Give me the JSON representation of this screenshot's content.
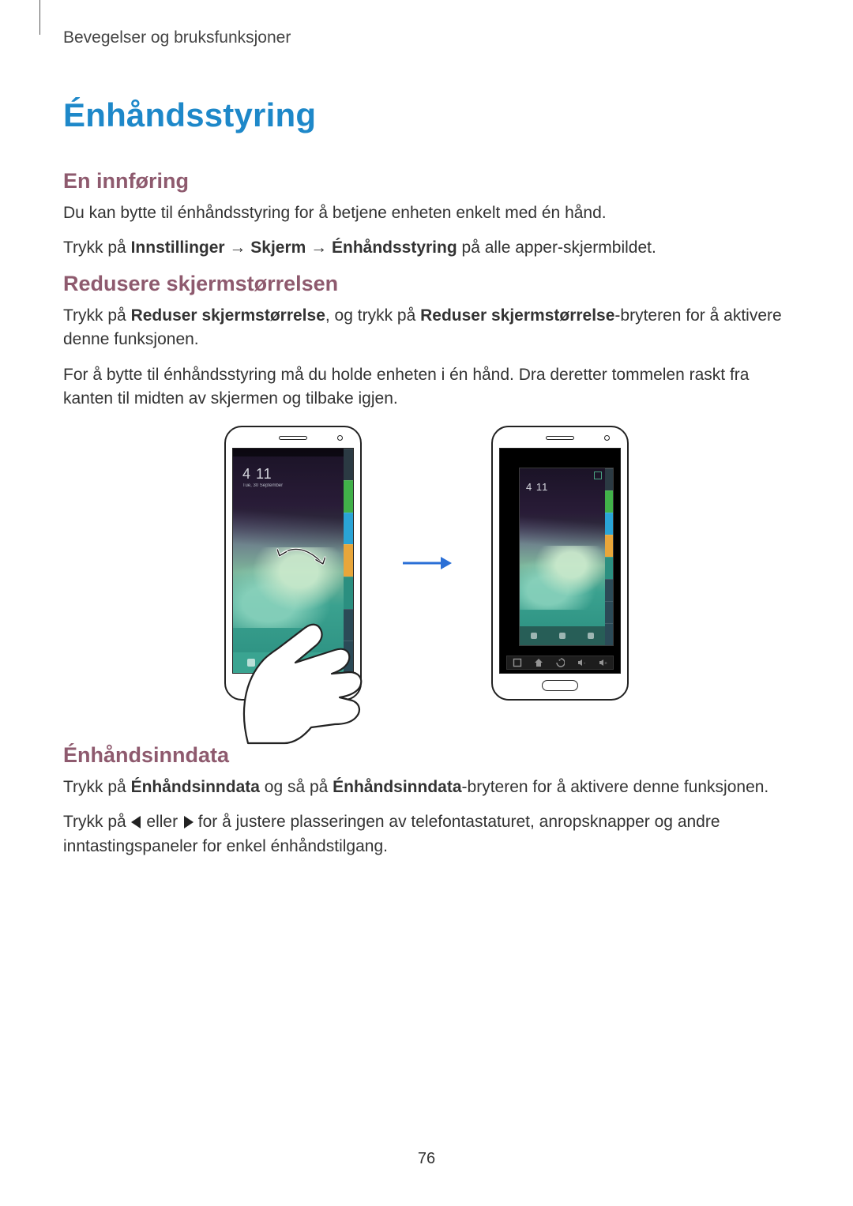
{
  "running_head": "Bevegelser og bruksfunksjoner",
  "title": "Énhåndsstyring",
  "intro": {
    "heading": "En innføring",
    "p1": "Du kan bytte til énhåndsstyring for å betjene enheten enkelt med én hånd.",
    "p2_pre": "Trykk på ",
    "p2_b1": "Innstillinger",
    "p2_arrow1": " → ",
    "p2_b2": "Skjerm",
    "p2_arrow2": " → ",
    "p2_b3": "Énhåndsstyring",
    "p2_post": " på alle apper-skjermbildet."
  },
  "reduce": {
    "heading": "Redusere skjermstørrelsen",
    "p1_pre": "Trykk på ",
    "p1_b1": "Reduser skjermstørrelse",
    "p1_mid": ", og trykk på ",
    "p1_b2": "Reduser skjermstørrelse",
    "p1_post": "-bryteren for å aktivere denne funksjonen.",
    "p2": "For å bytte til énhåndsstyring må du holde enheten i én hånd. Dra deretter tommelen raskt fra kanten til midten av skjermen og tilbake igjen."
  },
  "onehand_input": {
    "heading": "Énhåndsinndata",
    "p1_pre": "Trykk på ",
    "p1_b1": "Énhåndsinndata",
    "p1_mid": " og så på ",
    "p1_b2": "Énhåndsinndata",
    "p1_post": "-bryteren for å aktivere denne funksjonen.",
    "p2_pre": "Trykk på ",
    "p2_mid": " eller ",
    "p2_post": " for å justere plasseringen av telefontastaturet, anropsknapper og andre inntastingspaneler for enkel énhåndstilgang."
  },
  "figure": {
    "left_alt": "phone-full-swipe",
    "right_alt": "phone-reduced",
    "clock": "4 11",
    "clock_sub": "Tue, 30 September"
  },
  "page_number": "76"
}
